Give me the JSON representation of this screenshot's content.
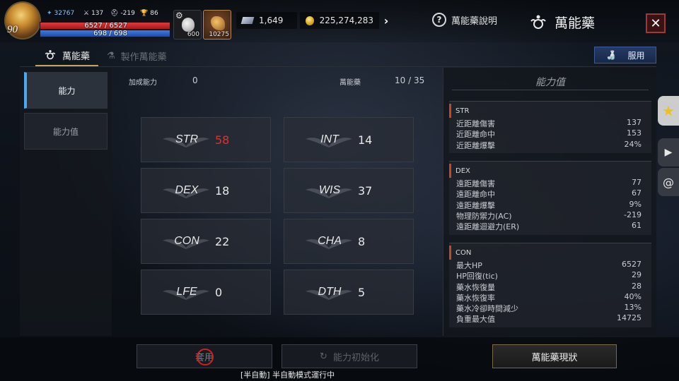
{
  "hud": {
    "level": "90",
    "power": "32767",
    "attack": "137",
    "defense": "-219",
    "trophy": "86",
    "hp": "6527 / 6527",
    "mp": "698 / 698",
    "hp_fraction": 1.0,
    "mp_fraction": 1.0,
    "item1_count": "600",
    "item2_count": "10275",
    "currency_gem": "1,649",
    "currency_gold": "225,274,283"
  },
  "header": {
    "help_label": "萬能藥說明",
    "title": "萬能藥"
  },
  "tabs": [
    {
      "label": "萬能藥"
    },
    {
      "label": "製作萬能藥"
    }
  ],
  "use_button": "服用",
  "leftnav": [
    {
      "label": "能力"
    },
    {
      "label": "能力值"
    }
  ],
  "center": {
    "bonus_label": "加成能力",
    "bonus_value": "0",
    "elixir_label": "萬能藥",
    "elixir_value": "10 / 35"
  },
  "stats": [
    {
      "name": "STR",
      "value": "58",
      "highlight": true
    },
    {
      "name": "INT",
      "value": "14"
    },
    {
      "name": "DEX",
      "value": "18"
    },
    {
      "name": "WIS",
      "value": "37"
    },
    {
      "name": "CON",
      "value": "22"
    },
    {
      "name": "CHA",
      "value": "8"
    },
    {
      "name": "LFE",
      "value": "0"
    },
    {
      "name": "DTH",
      "value": "5"
    }
  ],
  "rpanel": {
    "title": "能力值",
    "groups": [
      {
        "name": "STR",
        "rows": [
          {
            "k": "近距離傷害",
            "v": "137"
          },
          {
            "k": "近距離命中",
            "v": "153"
          },
          {
            "k": "近距離爆擊",
            "v": "24%"
          }
        ]
      },
      {
        "name": "DEX",
        "rows": [
          {
            "k": "遠距離傷害",
            "v": "77"
          },
          {
            "k": "遠距離命中",
            "v": "67"
          },
          {
            "k": "遠距離爆擊",
            "v": "9%"
          },
          {
            "k": "物理防禦力(AC)",
            "v": "-219"
          },
          {
            "k": "遠距離迴避力(ER)",
            "v": "61"
          }
        ]
      },
      {
        "name": "CON",
        "rows": [
          {
            "k": "最大HP",
            "v": "6527"
          },
          {
            "k": "HP回復(tic)",
            "v": "29"
          },
          {
            "k": "藥水恢復量",
            "v": "28"
          },
          {
            "k": "藥水恢復率",
            "v": "40%"
          },
          {
            "k": "藥水冷卻時間減少",
            "v": "13%"
          },
          {
            "k": "負重最大值",
            "v": "14725"
          }
        ]
      }
    ]
  },
  "bottom": {
    "apply_label": "套用",
    "reset_label": "能力初始化",
    "status_label": "萬能藥現狀",
    "mode_text": "[半自動] 半自動模式運行中"
  },
  "colors": {
    "accent_red": "#e23030",
    "accent_blue": "#4aa8f0",
    "hp_red": "#e23a3a",
    "mp_blue": "#3d7de0"
  }
}
